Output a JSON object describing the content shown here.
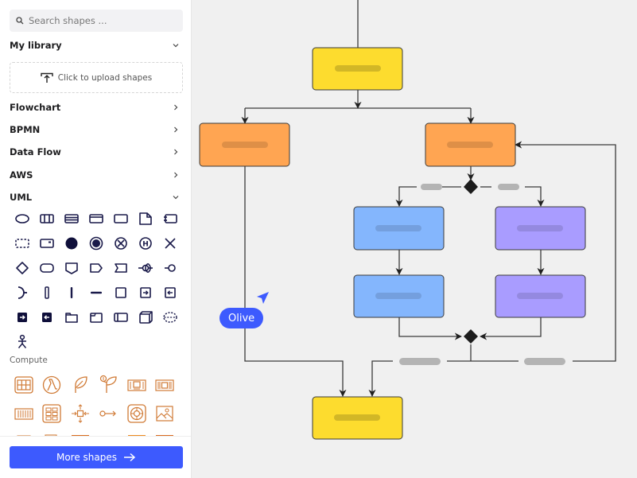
{
  "sidebar": {
    "search": {
      "placeholder": "Search shapes ...",
      "value": "",
      "icon": "search-icon"
    },
    "sections": [
      {
        "label": "My library",
        "state": "expanded",
        "icon": "chevron-down-icon"
      },
      {
        "label": "Flowchart",
        "state": "collapsed",
        "icon": "chevron-right-icon"
      },
      {
        "label": "BPMN",
        "state": "collapsed",
        "icon": "chevron-right-icon"
      },
      {
        "label": "Data Flow",
        "state": "collapsed",
        "icon": "chevron-right-icon"
      },
      {
        "label": "AWS",
        "state": "collapsed",
        "icon": "chevron-right-icon"
      },
      {
        "label": "UML",
        "state": "expanded",
        "icon": "chevron-down-icon"
      }
    ],
    "upload": {
      "label": "Click to upload shapes",
      "icon": "upload-icon"
    },
    "uml_shapes": [
      "ellipse",
      "class-box",
      "interface-box",
      "frame",
      "rectangle",
      "note",
      "component",
      "dashed-rect",
      "object-rect",
      "initial-node",
      "final-node",
      "flow-final",
      "history",
      "terminate",
      "diamond",
      "rounded-rect",
      "send-signal",
      "accept-signal",
      "event",
      "lollipop-provided",
      "lollipop-required",
      "required-interface",
      "lifeline",
      "activation",
      "message-line",
      "state",
      "entry-point",
      "exit-point",
      "port-in",
      "port-out",
      "package",
      "tab-frame",
      "swimlane",
      "node-3d",
      "dashed-ellipse",
      "actor"
    ],
    "compute_label": "Compute",
    "compute_shapes": [
      "aws-ec2-grid",
      "aws-lambda",
      "aws-leaf",
      "aws-sprout",
      "aws-instance",
      "aws-chip",
      "aws-rack",
      "aws-cluster",
      "aws-autoscaling",
      "aws-endpoint",
      "aws-lifebuoy",
      "aws-image",
      "aws-partial-1",
      "aws-partial-2",
      "aws-partial-3",
      "aws-partial-4",
      "aws-partial-5",
      "aws-partial-6"
    ],
    "more_button": {
      "label": "More shapes",
      "icon": "arrow-right-icon"
    }
  },
  "canvas": {
    "colors": {
      "yellow": "#fddc2e",
      "orange": "#ffa552",
      "blue": "#84b6fd",
      "purple": "#a99cff",
      "connector": "#3a3a3a",
      "label_placeholder": "#b4b4b4",
      "cursor": "#3d5afe"
    },
    "nodes": [
      {
        "id": "start",
        "color": "yellow"
      },
      {
        "id": "left-branch",
        "color": "orange"
      },
      {
        "id": "right-branch",
        "color": "orange"
      },
      {
        "id": "blue-1",
        "color": "blue"
      },
      {
        "id": "blue-2",
        "color": "blue"
      },
      {
        "id": "purple-1",
        "color": "purple"
      },
      {
        "id": "purple-2",
        "color": "purple"
      },
      {
        "id": "end",
        "color": "yellow"
      }
    ],
    "gateways": [
      {
        "id": "split",
        "type": "decision-diamond"
      },
      {
        "id": "merge",
        "type": "merge-diamond"
      }
    ],
    "collaborator_cursor": {
      "name": "Olive"
    }
  }
}
